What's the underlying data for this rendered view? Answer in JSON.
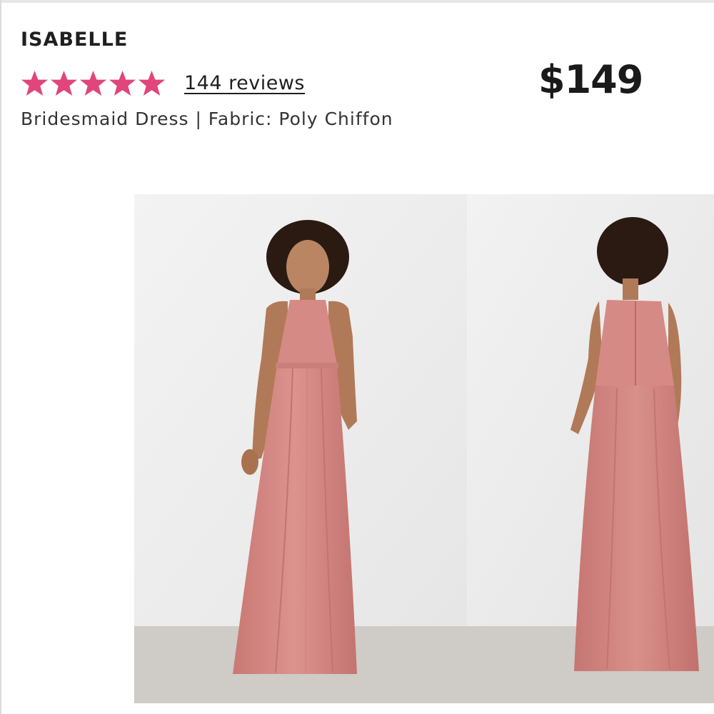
{
  "product": {
    "name": "ISABELLE",
    "rating": 5,
    "rating_max": 5,
    "reviews_label": "144 reviews",
    "price": "$149",
    "subtitle": "Bridesmaid Dress | Fabric: Poly Chiffon"
  },
  "gallery": {
    "images": [
      {
        "view": "front"
      },
      {
        "view": "back"
      }
    ]
  },
  "colors": {
    "star": "#e0457b",
    "dress": "#d68a86",
    "background_wall": "#eeeeee",
    "floor": "#cfcbc6"
  },
  "icons": [
    "star-icon"
  ]
}
